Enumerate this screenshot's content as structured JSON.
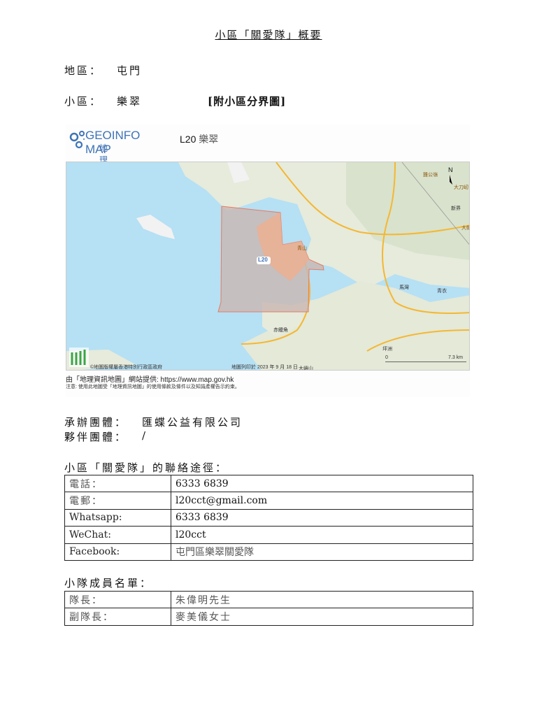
{
  "title": "小區「關愛隊」概要",
  "district": {
    "label": "地區：",
    "value": "屯門"
  },
  "subdistrict": {
    "label": "小區：",
    "value": "樂翠",
    "map_link": "[附小區分界圖]"
  },
  "map": {
    "logo_en": "GEOINFO MAP",
    "logo_zh": "地理資訊地圖",
    "code": "L20",
    "name": "樂翠",
    "region_label": "L20",
    "place_labels": [
      "雞公嶺",
      "大刀屻",
      "新界",
      "大帽",
      "青山",
      "馬灣",
      "青衣",
      "赤鱲角",
      "坪洲",
      "大嶼山"
    ],
    "north": "N",
    "scale_start": "0",
    "scale_end": "7.3 km",
    "copyright": "©地圖版權屬香港特別行政區政府",
    "print_date": "地圖列印於 2023 年 9 月 18 日",
    "credit": "由「地理資訊地圖」網站提供: https://www.map.gov.hk",
    "notice": "注意: 使用此地圖受「地理資訊地圖」的使用條款及條件以及知識產權告示約束。",
    "colors": {
      "sea": "#b6e0f4",
      "land": "#e9ecdf",
      "region": "#e8a890",
      "road": "#f5b731"
    }
  },
  "organizer": {
    "label": "承辦團體：",
    "value": "匯蝶公益有限公司"
  },
  "partner": {
    "label": "夥伴團體：",
    "value": "/"
  },
  "contact": {
    "heading": "小區「關愛隊」的聯絡途徑：",
    "rows": [
      {
        "label": "電話：",
        "value": "6333 6839"
      },
      {
        "label": "電郵：",
        "value": "l20cct@gmail.com"
      },
      {
        "label": "Whatsapp:",
        "value": "6333 6839"
      },
      {
        "label": "WeChat:",
        "value": "l20cct"
      },
      {
        "label": "Facebook:",
        "value": "屯門區樂翠關愛隊"
      }
    ]
  },
  "members": {
    "heading": "小隊成員名單：",
    "rows": [
      {
        "label": "隊長：",
        "value": "朱偉明先生"
      },
      {
        "label": "副隊長：",
        "value": "麥美儀女士"
      }
    ]
  }
}
